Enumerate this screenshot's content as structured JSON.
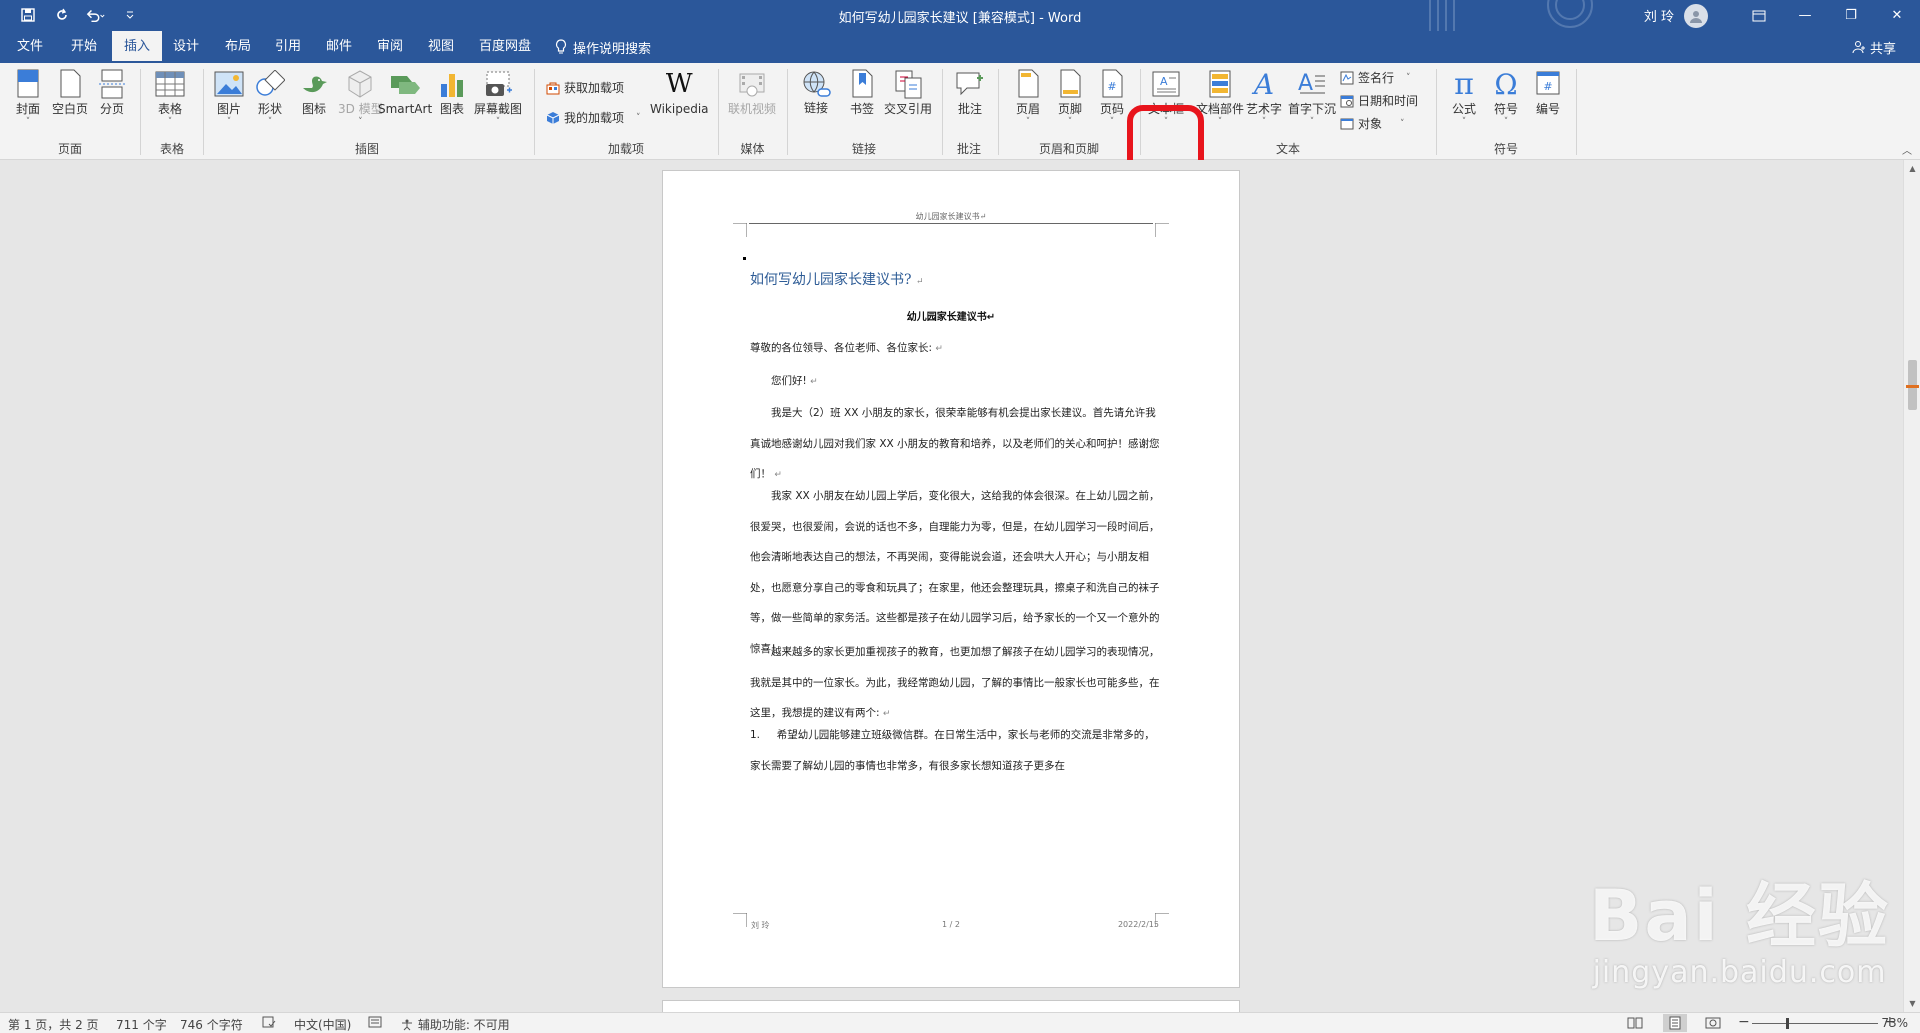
{
  "window": {
    "title": "如何写幼儿园家长建议 [兼容模式]  -  Word",
    "user": "刘 玲",
    "buttons": {
      "minimize": "—",
      "restore": "❐",
      "close": "✕"
    }
  },
  "quick_access": [
    {
      "icon": "save-icon",
      "glyph": "🖫"
    },
    {
      "icon": "redo-icon",
      "glyph": "↻"
    },
    {
      "icon": "undo-icon",
      "glyph": "↶ ˅"
    },
    {
      "icon": "customize-icon",
      "glyph": "⩡"
    }
  ],
  "menu": {
    "tabs": [
      "文件",
      "开始",
      "插入",
      "设计",
      "布局",
      "引用",
      "邮件",
      "审阅",
      "视图",
      "百度网盘"
    ],
    "active_tab": "插入",
    "search_hint": "操作说明搜索",
    "share": "共享"
  },
  "ribbon": {
    "pages": {
      "cover": "封面",
      "blank": "空白页",
      "break": "分页",
      "group": "页面"
    },
    "tables": {
      "table": "表格",
      "group": "表格"
    },
    "illustrations": {
      "pictures": "图片",
      "shapes": "形状",
      "icons": "图标",
      "model3d": "3D 模型",
      "smartart": "SmartArt",
      "chart": "图表",
      "screenshot": "屏幕截图",
      "group": "插图"
    },
    "addins": {
      "get": "获取加载项",
      "mine": "我的加载项",
      "wikipedia": "Wikipedia",
      "group": "加载项"
    },
    "media": {
      "video": "联机视频",
      "group": "媒体"
    },
    "links": {
      "link": "链接",
      "bookmark": "书签",
      "crossref": "交叉引用",
      "group": "链接"
    },
    "comments": {
      "comment": "批注",
      "group": "批注"
    },
    "header_footer": {
      "header": "页眉",
      "footer": "页脚",
      "pagenum": "页码",
      "group": "页眉和页脚"
    },
    "text": {
      "textbox": "文本框",
      "quickparts": "文档部件",
      "wordart": "艺术字",
      "dropcap": "首字下沉",
      "signature": "签名行",
      "datetime": "日期和时间",
      "object": "对象",
      "group": "文本"
    },
    "symbols": {
      "equation": "公式",
      "symbol": "符号",
      "numbering": "编号",
      "group": "符号"
    }
  },
  "document": {
    "header": "幼儿园家长建议书↵",
    "title": "如何写幼儿园家长建议书?",
    "subtitle": "幼儿园家长建议书↵",
    "greeting": "尊敬的各位领导、各位老师、各位家长:",
    "hello": "您们好!",
    "paragraphs": [
      "我是大（2）班 XX 小朋友的家长，很荣幸能够有机会提出家长建议。首先请允许我真诚地感谢幼儿园对我们家 XX 小朋友的教育和培养，以及老师们的关心和呵护！感谢您们！",
      "我家 XX 小朋友在幼儿园上学后，变化很大，这给我的体会很深。在上幼儿园之前，很爱哭，也很爱闹，会说的话也不多，自理能力为零，但是，在幼儿园学习一段时间后，他会清晰地表达自己的想法，不再哭闹，变得能说会道，还会哄大人开心；与小朋友相处，也愿意分享自己的零食和玩具了；在家里，他还会整理玩具，擦桌子和洗自己的袜子等，做一些简单的家务活。这些都是孩子在幼儿园学习后，给予家长的一个又一个意外的惊喜！",
      "越来越多的家长更加重视孩子的教育，也更加想了解孩子在幼儿园学习的表现情况，我就是其中的一位家长。为此，我经常跑幼儿园，了解的事情比一般家长也可能多些，在这里，我想提的建议有两个:"
    ],
    "list_item_number": "1.",
    "list_item_text": "希望幼儿园能够建立班级微信群。在日常生活中，家长与老师的交流是非常多的，家长需要了解幼儿园的事情也非常多，有很多家长想知道孩子更多在",
    "footer_left": "刘 玲",
    "footer_center": "1 / 2",
    "footer_right": "2022/2/15"
  },
  "status": {
    "page": "第 1 页，共 2 页",
    "words": "711 个字",
    "chars": "746 个字符",
    "lang": "中文(中国)",
    "accessibility": "辅助功能: 不可用",
    "zoom": "73%",
    "zoom_level": 0.73
  },
  "watermark": {
    "brand": "Bai 经验",
    "url": "jingyan.baidu.com"
  },
  "colors": {
    "accent": "#2b579a",
    "highlight": "#e8141c",
    "link_title": "#2e5c96"
  }
}
